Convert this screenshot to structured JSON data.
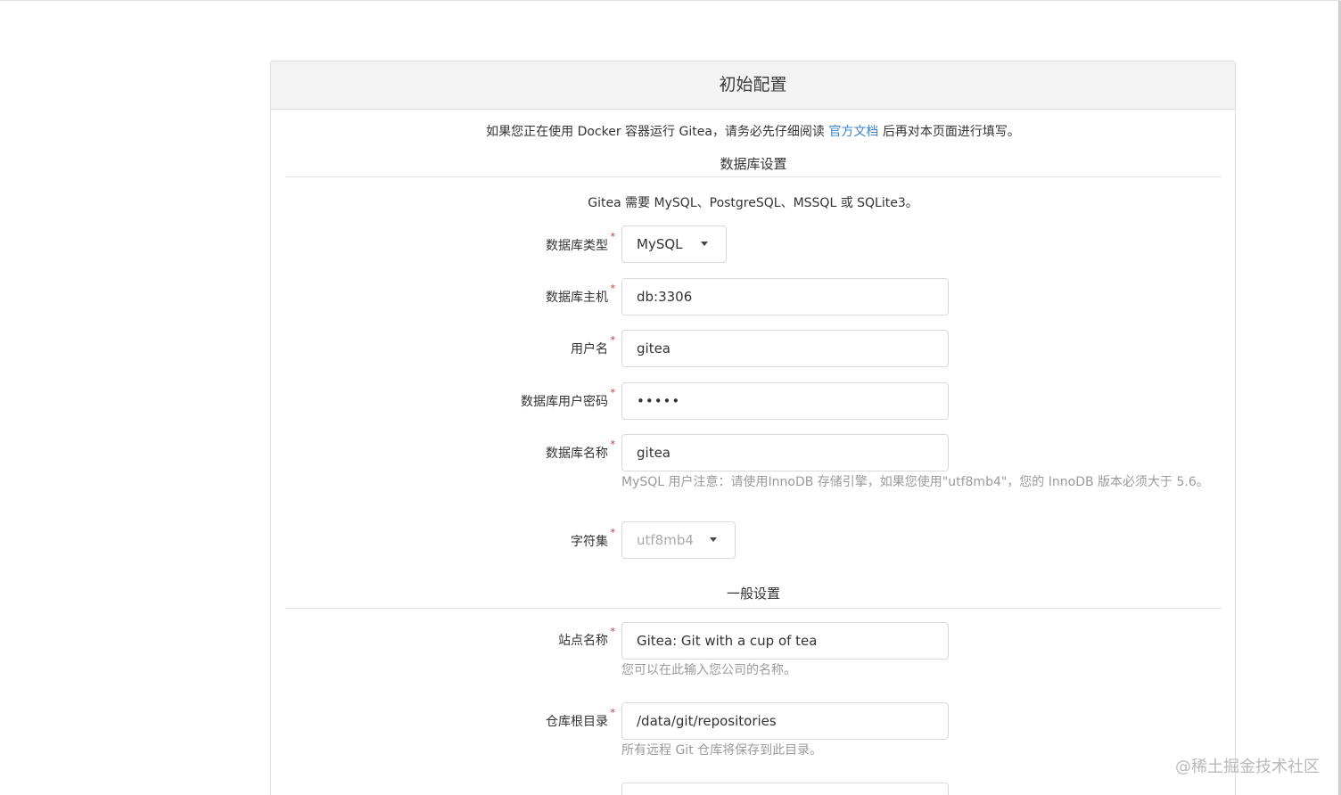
{
  "header": {
    "title": "初始配置"
  },
  "notice": {
    "prefix": "如果您正在使用 Docker 容器运行 Gitea，请务必先仔细阅读 ",
    "link_text": "官方文档",
    "suffix": " 后再对本页面进行填写。"
  },
  "db_section": {
    "title": "数据库设置",
    "info": "Gitea 需要 MySQL、PostgreSQL、MSSQL 或 SQLite3。",
    "fields": {
      "db_type": {
        "label": "数据库类型",
        "value": "MySQL"
      },
      "db_host": {
        "label": "数据库主机",
        "value": "db:3306"
      },
      "db_user": {
        "label": "用户名",
        "value": "gitea"
      },
      "db_password": {
        "label": "数据库用户密码",
        "value": "•••••"
      },
      "db_name": {
        "label": "数据库名称",
        "value": "gitea",
        "help": "MySQL 用户注意：请使用InnoDB 存储引擎，如果您使用\"utf8mb4\"，您的 InnoDB 版本必须大于 5.6。"
      },
      "charset": {
        "label": "字符集",
        "value": "utf8mb4"
      }
    }
  },
  "general_section": {
    "title": "一般设置",
    "fields": {
      "site_name": {
        "label": "站点名称",
        "value": "Gitea: Git with a cup of tea",
        "help": "您可以在此输入您公司的名称。"
      },
      "repo_root": {
        "label": "仓库根目录",
        "value": "/data/git/repositories",
        "help": "所有远程 Git 仓库将保存到此目录。"
      }
    }
  },
  "required_mark": "*",
  "watermark": "@稀土掘金技术社区"
}
